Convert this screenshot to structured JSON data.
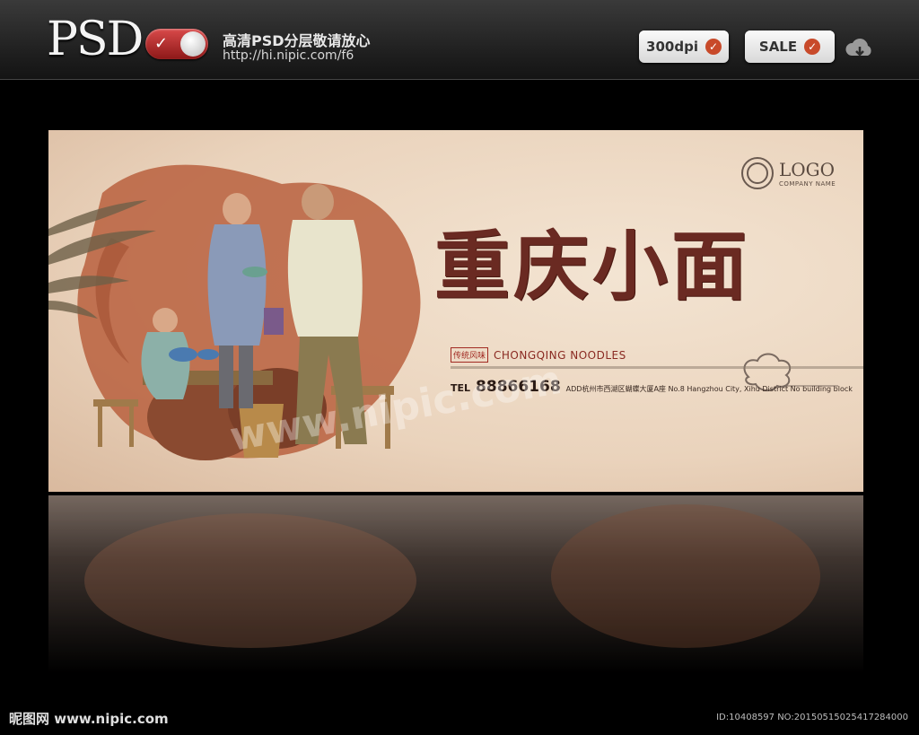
{
  "header": {
    "logo": "PSD",
    "promo_line1": "高清PSD分层敬请放心",
    "promo_line2": "http://hi.nipic.com/f6",
    "badges": [
      {
        "label": "300dpi"
      },
      {
        "label": "SALE"
      }
    ],
    "icons": [
      "toggle-check-icon",
      "check-icon",
      "cloud-download-icon"
    ]
  },
  "poster": {
    "title": "重庆小面",
    "logo_text": "LOGO",
    "logo_sub": "COMPANY NAME",
    "seal_text": "传统风味",
    "en_name": "CHONGQING NOODLES",
    "tel_label": "TEL",
    "tel_number": "88866168",
    "address": "ADD杭州市西湖区蝴蝶大厦A座 No.8 Hangzhou City, Xihu District No building block",
    "watermark": "www.nipic.com"
  },
  "footer": {
    "left": "昵图网 www.nipic.com",
    "right": "ID:10408597 NO:20150515025417284000"
  },
  "colors": {
    "accent": "#c84a2a",
    "title": "#6a2a22",
    "poster_bg": "#ead3bc"
  }
}
